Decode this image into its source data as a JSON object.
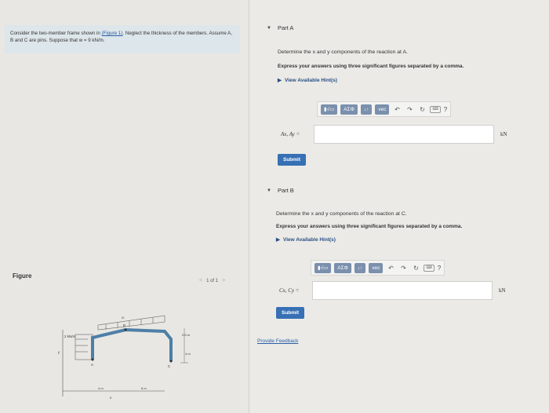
{
  "problem": {
    "text_before_link": "Consider the two-member frame shown in ",
    "link": "(Figure 1)",
    "text_after_link": ". Neglect the thickness of the members. Assume A, B and C are pins. Suppose that w = 9 kN/m."
  },
  "figure": {
    "label": "Figure",
    "pager_prev": "<",
    "pager_text": "1 of 1",
    "pager_next": ">",
    "load_left": "2 kN/m",
    "load_top": "w",
    "label_b": "B",
    "label_a": "A",
    "label_c": "C",
    "dim_right_top": "2.5 m",
    "dim_right_bottom": "4 m",
    "dim_bottom_left": "4 m",
    "dim_bottom_right": "6 m",
    "axis_y": "y",
    "axis_x": "x"
  },
  "partA": {
    "title": "Part A",
    "question": "Determine the x and y components of the reaction at A.",
    "instruction": "Express your answers using three significant figures separated by a comma.",
    "hint": "View Available Hint(s)",
    "label": "Ax, Ay =",
    "unit": "kN",
    "submit": "Submit"
  },
  "partB": {
    "title": "Part B",
    "question": "Determine the x and y components of the reaction at C.",
    "instruction": "Express your answers using three significant figures separated by a comma.",
    "hint": "View Available Hint(s)",
    "label": "Cx, Cy =",
    "unit": "kN",
    "submit": "Submit"
  },
  "toolbar": {
    "templates": "▮√▭",
    "greek": "ΑΣΦ",
    "arrows": "↓↑",
    "vec": "vec",
    "keyboard": "⌨",
    "help": "?"
  },
  "feedback": "Provide Feedback"
}
